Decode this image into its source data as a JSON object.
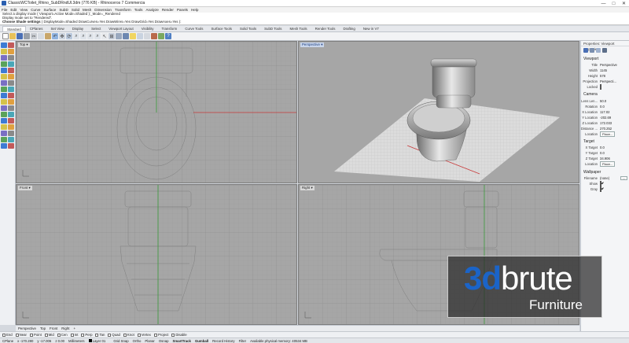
{
  "window": {
    "title": "ClassicWCToilet_Rhino_SubDRndUl.3dm (776 KB) - Rhinoceros 7 Commercia",
    "minimize": "—",
    "maximize": "□",
    "close": "✕"
  },
  "menu": [
    "File",
    "Edit",
    "View",
    "Curve",
    "Surface",
    "SubD",
    "Solid",
    "Mesh",
    "Dimension",
    "Transform",
    "Tools",
    "Analyze",
    "Render",
    "Panels",
    "Help"
  ],
  "command_history": {
    "line1": "Select a display mode ( Viewport=Active  Mode=Shaded ):_Mode=_Rendered",
    "line2": "Display mode set to \"Rendered\".",
    "prompt_label": "Choose Shade settings",
    "prompt_options": "( DisplayMode=Shaded  DrawCurves=Yes  DrawWires=Yes  DrawGrid=Yes  DrawAxes=Yes ):"
  },
  "toolbar_tabs": [
    "Standard",
    "CPlanes",
    "Set View",
    "Display",
    "Select",
    "Viewport Layout",
    "Visibility",
    "Transform",
    "Curve Tools",
    "Surface Tools",
    "Solid Tools",
    "SubD Tools",
    "Mesh Tools",
    "Render Tools",
    "Drafting",
    "New in V7"
  ],
  "viewports": {
    "top": {
      "label": "Top"
    },
    "perspective": {
      "label": "Perspective"
    },
    "front": {
      "label": "Front"
    },
    "right": {
      "label": "Right"
    },
    "dropdown": "▾"
  },
  "viewport_tabs": [
    "Perspective",
    "Top",
    "Front",
    "Right",
    "+"
  ],
  "osnaps": [
    "End",
    "Near",
    "Point",
    "Mid",
    "Cen",
    "Int",
    "Perp",
    "Tan",
    "Quad",
    "Knot",
    "Vertex",
    "Project",
    "Disable"
  ],
  "status_bar": {
    "cplane": "CPlane",
    "x": "x -170.280",
    "y": "y -17.006",
    "z": "z 0.00",
    "units": "Millimeters",
    "layer": "Layer 01",
    "grid_snap": "Grid Snap",
    "ortho": "Ortho",
    "planar": "Planar",
    "osnap": "Osnap",
    "smarttrack": "SmartTrack",
    "gumball": "Gumball",
    "record_history": "Record History",
    "filter": "Filter",
    "memory": "Available physical memory: 40534 MB"
  },
  "properties_panel": {
    "header": "Properties: Viewport properties",
    "viewport_section": "Viewport",
    "viewport_rows": [
      {
        "label": "Title",
        "value": "Perspective"
      },
      {
        "label": "Width",
        "value": "1145"
      },
      {
        "label": "Height",
        "value": "578"
      },
      {
        "label": "Projection",
        "value": "Perspecti..."
      },
      {
        "label": "Locked",
        "value": ""
      }
    ],
    "camera_section": "Camera",
    "camera_rows": [
      {
        "label": "Lens Len...",
        "value": "50.0"
      },
      {
        "label": "Rotation",
        "value": "0.0"
      },
      {
        "label": "X Location",
        "value": "117.02"
      },
      {
        "label": "Y Location",
        "value": "-202.69"
      },
      {
        "label": "Z Location",
        "value": "172.033"
      },
      {
        "label": "Distance ...",
        "value": "270.252"
      },
      {
        "label": "Location",
        "value": "Place..."
      }
    ],
    "target_section": "Target",
    "target_rows": [
      {
        "label": "X Target",
        "value": "0.0"
      },
      {
        "label": "Y Target",
        "value": "0.0"
      },
      {
        "label": "Z Target",
        "value": "34.906"
      },
      {
        "label": "Location",
        "value": "Place..."
      }
    ],
    "wallpaper_section": "Wallpaper",
    "wallpaper_rows": [
      {
        "label": "Filename",
        "value": "(none)"
      },
      {
        "label": "Show",
        "value": ""
      },
      {
        "label": "Gray",
        "value": ""
      }
    ],
    "wallpaper_browse": "...",
    "locked_checked": false,
    "show_checked": true,
    "gray_checked": true
  },
  "watermark": {
    "brand_prefix": "3d",
    "brand_suffix": "brute",
    "tagline": "Furniture"
  },
  "colors": {
    "viewport_bg": "#a6a6a6",
    "grid_line": "#9a9a9a",
    "x_axis": "#c83a3a",
    "y_axis": "#3aa63a",
    "active_viewport_label": "#1a3a7a",
    "brand_blue": "#1b64c8"
  }
}
